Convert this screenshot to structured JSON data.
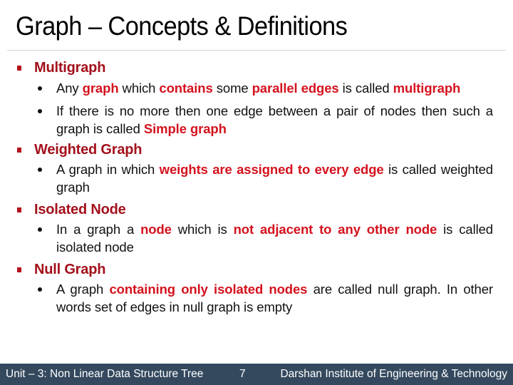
{
  "slide": {
    "title": "Graph – Concepts & Definitions",
    "colors": {
      "heading": "#a3101b",
      "highlight": "#d4121e",
      "footer_bg": "#34495e",
      "divider": "#d6d6d6"
    },
    "sections": [
      {
        "heading": "Multigraph",
        "items": [
          {
            "segments": [
              {
                "text": "Any ",
                "highlight": false
              },
              {
                "text": "graph",
                "highlight": true
              },
              {
                "text": " which ",
                "highlight": false
              },
              {
                "text": "contains",
                "highlight": true
              },
              {
                "text": " some ",
                "highlight": false
              },
              {
                "text": "parallel edges",
                "highlight": true
              },
              {
                "text": " is called ",
                "highlight": false
              },
              {
                "text": "multigraph",
                "highlight": true
              }
            ]
          },
          {
            "segments": [
              {
                "text": "If there is no more then one edge between a pair of nodes then such a graph is called ",
                "highlight": false
              },
              {
                "text": "Simple graph",
                "highlight": true
              }
            ]
          }
        ]
      },
      {
        "heading": "Weighted Graph",
        "items": [
          {
            "segments": [
              {
                "text": "A graph in which ",
                "highlight": false
              },
              {
                "text": "weights are assigned to every edge",
                "highlight": true
              },
              {
                "text": " is called weighted graph",
                "highlight": false
              }
            ]
          }
        ]
      },
      {
        "heading": "Isolated Node",
        "items": [
          {
            "segments": [
              {
                "text": "In a graph a ",
                "highlight": false
              },
              {
                "text": "node",
                "highlight": true
              },
              {
                "text": " which is ",
                "highlight": false
              },
              {
                "text": "not adjacent to any other node",
                "highlight": true
              },
              {
                "text": " is called isolated node",
                "highlight": false
              }
            ]
          }
        ]
      },
      {
        "heading": "Null Graph",
        "items": [
          {
            "segments": [
              {
                "text": "A graph ",
                "highlight": false
              },
              {
                "text": "containing only isolated nodes",
                "highlight": true
              },
              {
                "text": " are called null graph. In other words set of edges in null graph is empty",
                "highlight": false
              }
            ]
          }
        ]
      }
    ]
  },
  "footer": {
    "unit": "Unit – 3: Non Linear Data Structure  Tree",
    "page": "7",
    "institute": "Darshan Institute of Engineering & Technology"
  }
}
